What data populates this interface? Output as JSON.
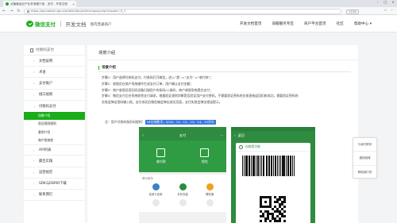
{
  "browser": {
    "tab_title": "点聚营运业户业务流程介绍 - 支付 - 开发文档",
    "url": "https://pay.weixin.qq.com/wiki/doc/api/micropay.php?chapter=5_1",
    "zoom": "110%"
  },
  "header": {
    "logo_text": "微信支付",
    "doc_title": "开发文档",
    "doc_subtitle": "境内普通商户",
    "nav": [
      "开发文档首页",
      "旧服服务专区",
      "商户平台首页",
      "社区",
      "帮助中心"
    ]
  },
  "sidebar": {
    "title": "付款码支付",
    "items": [
      {
        "label": "文档说明"
      },
      {
        "label": "术语"
      },
      {
        "label": "支付账户"
      },
      {
        "label": "接口规则"
      },
      {
        "label": "付款码支付"
      }
    ],
    "sub_items": [
      {
        "label": "场景介绍",
        "active": true
      },
      {
        "label": "验证规则规则",
        "active": false
      },
      {
        "label": "案例介绍",
        "active": false
      },
      {
        "label": "商户侧流程",
        "active": false
      }
    ],
    "items_after": [
      {
        "label": "API列表"
      },
      {
        "label": "最佳实践"
      },
      {
        "label": "运营规范"
      },
      {
        "label": "SDK与DEMO下载"
      },
      {
        "label": "联系我们"
      }
    ]
  },
  "content": {
    "heading": "场景介绍",
    "section_title": "场景介绍",
    "steps": [
      "步骤1：用户选择付款码支付，付款码打开微信，进入“我”->“支付”->“收付款”；",
      "步骤2：收银员在商户系统操作生成支付订单，用户确认支付金额；",
      "步骤3：商户收银员用扫码设备扫描用户的条码/二维码，商户收银系统提交支付；",
      "步骤4：微信支付后台系统收到支付请求，根据验证规则判断是否验证用户支付密码，不需要验证密码的交易直接返回扣款成功，需要验证密码的",
      "交易会弹出密码输入框。支付成功后微信端会弹出成功页面，支付失败会弹出错误提示。"
    ],
    "note_prefix": "注：用户付款码条形码规则：",
    "note_highlight": "18位纯数字，以10、11、12、13、14、15开头"
  },
  "phone1": {
    "nav_title": "支付",
    "big_buttons": [
      "收付款",
      "钱包"
    ],
    "grid_title": "腾讯服务",
    "grid_row1": [
      "信用卡还款",
      "手机充值",
      "理财通"
    ],
    "grid_colors": [
      "#3b82c4",
      "#2e8b3f",
      "#f0a020"
    ]
  },
  "phone2": {
    "nav_title": "返回",
    "card_title": "向商家付款"
  },
  "float_widget": {
    "items": [
      "与我们联系",
      "遇到困难",
      "帮助我们的"
    ]
  }
}
